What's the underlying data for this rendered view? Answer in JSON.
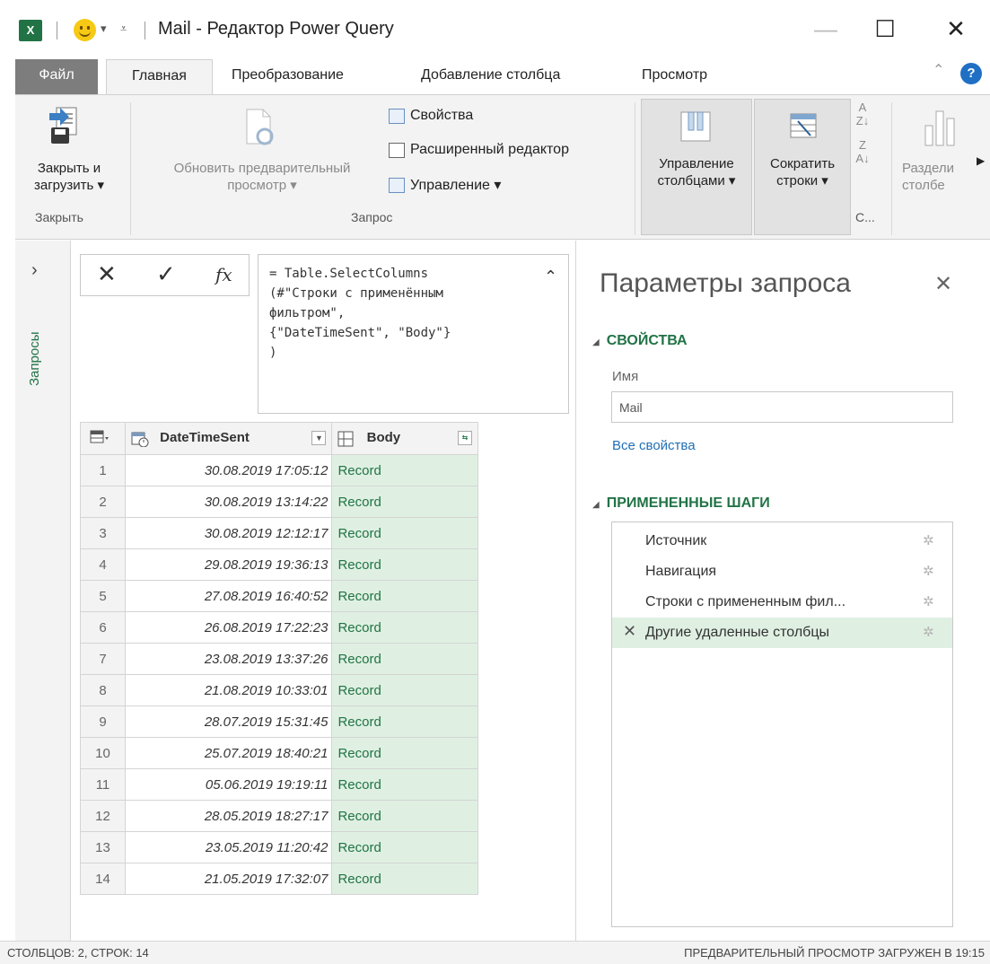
{
  "window": {
    "title": "Mail - Редактор Power Query",
    "app_icon": "X",
    "qat_arrow": "▾",
    "qat_customize": "⩡",
    "minimize": "—",
    "maximize": "☐",
    "close": "✕"
  },
  "tabs": [
    "Файл",
    "Главная",
    "Преобразование",
    "Добавление столбца",
    "Просмотр"
  ],
  "active_tab": "Главная",
  "ribbon": {
    "close_load_line1": "Закрыть и",
    "close_load_line2": "загрузить ▾",
    "group_close": "Закрыть",
    "refresh_line1": "Обновить предварительный",
    "refresh_line2": "просмотр ▾",
    "properties": "Свойства",
    "advanced_editor": "Расширенный редактор",
    "manage": "Управление ▾",
    "group_query": "Запрос",
    "manage_columns_line1": "Управление",
    "manage_columns_line2": "столбцами ▾",
    "reduce_rows_line1": "Сократить",
    "reduce_rows_line2": "строки ▾",
    "group_sort_abbr": "С...",
    "split_line1": "Раздели",
    "split_line2": "столбе"
  },
  "queries_pane": {
    "label": "Запросы"
  },
  "formula": {
    "text": "= Table.SelectColumns\n(#\"Строки с применённым\nфильтром\",\n{\"DateTimeSent\", \"Body\"}\n)"
  },
  "grid": {
    "columns": [
      "DateTimeSent",
      "Body"
    ],
    "rows": [
      {
        "n": "1",
        "dt": "30.08.2019 17:05:12",
        "body": "Record"
      },
      {
        "n": "2",
        "dt": "30.08.2019 13:14:22",
        "body": "Record"
      },
      {
        "n": "3",
        "dt": "30.08.2019 12:12:17",
        "body": "Record"
      },
      {
        "n": "4",
        "dt": "29.08.2019 19:36:13",
        "body": "Record"
      },
      {
        "n": "5",
        "dt": "27.08.2019 16:40:52",
        "body": "Record"
      },
      {
        "n": "6",
        "dt": "26.08.2019 17:22:23",
        "body": "Record"
      },
      {
        "n": "7",
        "dt": "23.08.2019 13:37:26",
        "body": "Record"
      },
      {
        "n": "8",
        "dt": "21.08.2019 10:33:01",
        "body": "Record"
      },
      {
        "n": "9",
        "dt": "28.07.2019 15:31:45",
        "body": "Record"
      },
      {
        "n": "10",
        "dt": "25.07.2019 18:40:21",
        "body": "Record"
      },
      {
        "n": "11",
        "dt": "05.06.2019 19:19:11",
        "body": "Record"
      },
      {
        "n": "12",
        "dt": "28.05.2019 18:27:17",
        "body": "Record"
      },
      {
        "n": "13",
        "dt": "23.05.2019 11:20:42",
        "body": "Record"
      },
      {
        "n": "14",
        "dt": "21.05.2019 17:32:07",
        "body": "Record"
      }
    ]
  },
  "query_settings": {
    "title": "Параметры запроса",
    "properties_header": "СВОЙСТВА",
    "name_label": "Имя",
    "name_value": "Mail",
    "all_properties": "Все свойства",
    "applied_steps_header": "ПРИМЕНЕННЫЕ ШАГИ",
    "steps": [
      "Источник",
      "Навигация",
      "Строки с примененным фил...",
      "Другие удаленные столбцы"
    ],
    "selected_step": "Другие удаленные столбцы"
  },
  "status": {
    "left": "СТОЛБЦОВ: 2, СТРОК: 14",
    "right": "ПРЕДВАРИТЕЛЬНЫЙ ПРОСМОТР ЗАГРУЖЕН В 19:15"
  },
  "colors": {
    "excel_green": "#217346",
    "record_bg": "#dff0e2",
    "ribbon_bg": "#f3f3f3",
    "file_tab": "#7d7d7d",
    "link_blue": "#1f6fb5"
  }
}
